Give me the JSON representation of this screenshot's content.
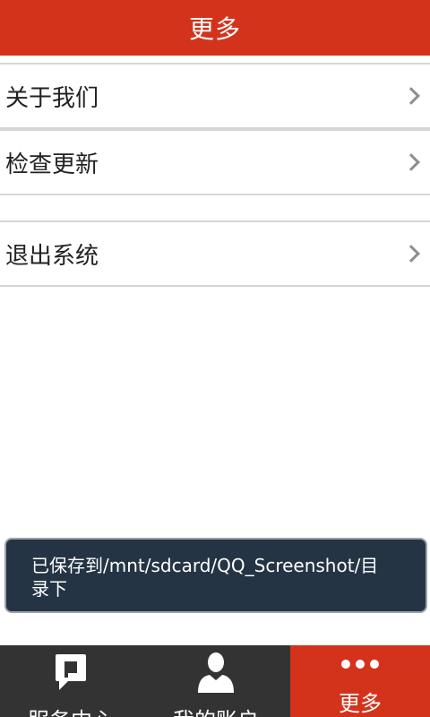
{
  "header": {
    "title": "更多"
  },
  "menu": {
    "items": [
      {
        "label": "关于我们",
        "icon": "chevron-right-icon"
      },
      {
        "label": "检查更新",
        "icon": "chevron-right-icon"
      },
      {
        "label": "退出系统",
        "icon": "chevron-right-icon"
      }
    ]
  },
  "toast": {
    "message": "已保存到/mnt/sdcard/QQ_Screenshot/目录下"
  },
  "tabbar": {
    "tabs": [
      {
        "label": "服务中心",
        "icon": "chat-bubble-icon",
        "active": false
      },
      {
        "label": "我的账户",
        "icon": "user-icon",
        "active": false
      },
      {
        "label": "更多",
        "icon": "more-dots-icon",
        "active": true
      }
    ]
  },
  "colors": {
    "accent": "#d4331b",
    "tabbar_bg": "#333333",
    "toast_bg": "#243444",
    "divider": "#d6d6d6"
  }
}
